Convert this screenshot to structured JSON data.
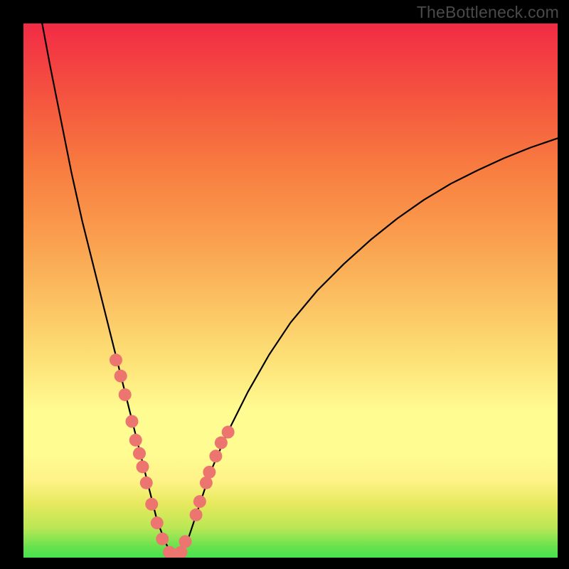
{
  "watermark_text": "TheBottleneck.com",
  "colors": {
    "frame": "#000000",
    "curve": "#000000",
    "marker": "#ec7570",
    "gradient_top": "#f22b45",
    "gradient_bottom": "#47e24e"
  },
  "chart_data": {
    "type": "line",
    "title": "",
    "xlabel": "",
    "ylabel": "",
    "xlim": [
      0,
      100
    ],
    "ylim": [
      0,
      100
    ],
    "grid": false,
    "series": [
      {
        "name": "bottleneck-curve",
        "x": [
          3.5,
          5,
          7,
          9,
          11,
          13,
          15,
          17,
          19,
          20.5,
          22,
          23.5,
          25,
          26.5,
          28,
          29,
          31,
          33,
          35,
          38,
          42,
          46,
          50,
          55,
          60,
          65,
          70,
          75,
          80,
          85,
          90,
          95,
          100
        ],
        "y": [
          100,
          92,
          82,
          72,
          63,
          55,
          47,
          39,
          31,
          25,
          19,
          13,
          7,
          3,
          0,
          0,
          4,
          10,
          16,
          23,
          31,
          38,
          44,
          50,
          55,
          59.5,
          63.5,
          67,
          70,
          72.5,
          74.8,
          76.8,
          78.5
        ]
      }
    ],
    "markers": {
      "name": "highlight-points",
      "x": [
        17.3,
        18.2,
        19.0,
        20.3,
        21.0,
        21.7,
        22.3,
        23.0,
        24.0,
        25.0,
        26.0,
        27.3,
        28.3,
        29.5,
        30.3,
        32.3,
        33.0,
        34.2,
        34.8,
        36.0,
        37.0,
        38.3
      ],
      "y": [
        37.0,
        34.0,
        30.5,
        25.5,
        22.0,
        19.5,
        17.0,
        14.0,
        10.0,
        6.5,
        3.5,
        1.0,
        0.5,
        1.0,
        3.0,
        8.0,
        10.5,
        14.0,
        16.0,
        19.0,
        21.5,
        23.5
      ]
    }
  }
}
